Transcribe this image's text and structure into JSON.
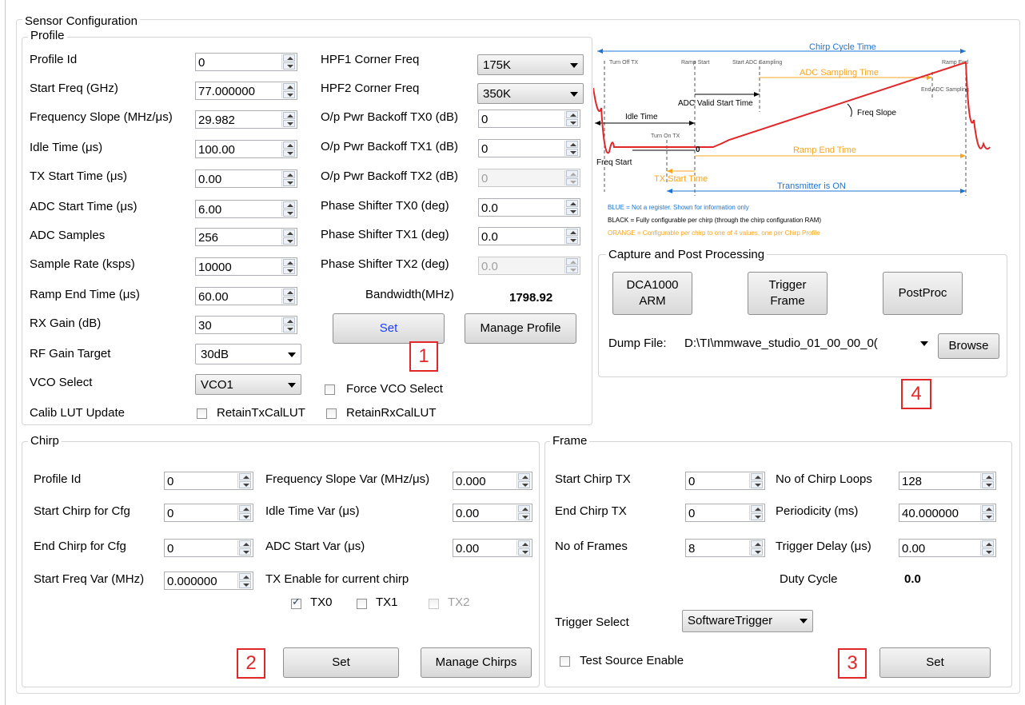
{
  "window": {
    "title": "Sensor Configuration"
  },
  "markers": [
    "1",
    "2",
    "3",
    "4"
  ],
  "profile": {
    "title": "Profile",
    "left_fields": [
      {
        "label": "Profile Id",
        "value": "0"
      },
      {
        "label": "Start Freq (GHz)",
        "value": "77.000000"
      },
      {
        "label": "Frequency Slope (MHz/μs)",
        "value": "29.982"
      },
      {
        "label": "Idle Time (μs)",
        "value": "100.00"
      },
      {
        "label": "TX Start Time (μs)",
        "value": "0.00"
      },
      {
        "label": "ADC Start Time (μs)",
        "value": "6.00"
      },
      {
        "label": "ADC Samples",
        "value": "256"
      },
      {
        "label": "Sample Rate (ksps)",
        "value": "10000"
      },
      {
        "label": "Ramp End Time (μs)",
        "value": "60.00"
      },
      {
        "label": "RX Gain (dB)",
        "value": "30"
      }
    ],
    "rf_gain_target": {
      "label": "RF Gain Target",
      "value": "30dB"
    },
    "vco_select": {
      "label": "VCO Select",
      "value": "VCO1"
    },
    "force_vco": {
      "label": "Force VCO Select",
      "checked": false
    },
    "calib": {
      "label": "Calib LUT Update",
      "tx_label": "RetainTxCalLUT",
      "rx_label": "RetainRxCalLUT"
    },
    "hpf1": {
      "label": "HPF1 Corner Freq",
      "value": "175K"
    },
    "hpf2": {
      "label": "HPF2 Corner Freq",
      "value": "350K"
    },
    "right_fields": [
      {
        "label": "O/p Pwr Backoff TX0 (dB)",
        "value": "0",
        "disabled": false
      },
      {
        "label": "O/p Pwr Backoff TX1 (dB)",
        "value": "0",
        "disabled": false
      },
      {
        "label": "O/p Pwr Backoff TX2 (dB)",
        "value": "0",
        "disabled": true
      },
      {
        "label": "Phase Shifter TX0 (deg)",
        "value": "0.0",
        "disabled": false
      },
      {
        "label": "Phase Shifter TX1 (deg)",
        "value": "0.0",
        "disabled": false
      },
      {
        "label": "Phase Shifter TX2 (deg)",
        "value": "0.0",
        "disabled": true
      }
    ],
    "bandwidth_label": "Bandwidth(MHz)",
    "bandwidth_value": "1798.92",
    "set_label": "Set",
    "manage_label": "Manage Profile"
  },
  "diagram": {
    "chirp_cycle": "Chirp Cycle Time",
    "turn_off_tx": "Turn Off TX",
    "ramp_start": "Ramp Start",
    "start_adc": "Start ADC Sampling",
    "ramp_end": "Ramp End",
    "adc_sampling_time": "ADC Sampling Time",
    "end_adc": "End ADC Sampling",
    "adc_valid_start": "ADC Valid Start Time",
    "idle_time": "Idle Time",
    "freq_slope": "Freq Slope",
    "turn_on_tx": "Turn On TX",
    "zero": "0",
    "ramp_end_time": "Ramp End Time",
    "freq_start": "Freq Start",
    "tx_start_time": "TX Start Time",
    "transmitter_on": "Transmitter is ON",
    "legend_blue": "BLUE = Not a register. Shown for information only",
    "legend_black": "BLACK = Fully configurable per chirp (through the chirp configuration RAM)",
    "legend_orange": "ORANGE = Configurable per chirp to one of 4 values, one per Chirp Profile",
    "colors": {
      "blue": "#1e73d2",
      "orange": "#f5a623",
      "red": "#e0282a"
    }
  },
  "capture": {
    "title": "Capture and Post Processing",
    "dca_label": "DCA1000 ARM",
    "trigger_label": "Trigger Frame",
    "postproc_label": "PostProc",
    "dump_label": "Dump File:",
    "dump_value": "D:\\TI\\mmwave_studio_01_00_00_0(",
    "browse_label": "Browse"
  },
  "chirp": {
    "title": "Chirp",
    "left_fields": [
      {
        "label": "Profile Id",
        "value": "0"
      },
      {
        "label": "Start Chirp for Cfg",
        "value": "0"
      },
      {
        "label": "End Chirp for Cfg",
        "value": "0"
      },
      {
        "label": "Start Freq Var (MHz)",
        "value": "0.000000"
      }
    ],
    "right_fields": [
      {
        "label": "Frequency Slope Var (MHz/μs)",
        "value": "0.000"
      },
      {
        "label": "Idle Time Var (μs)",
        "value": "0.00"
      },
      {
        "label": "ADC Start Var (μs)",
        "value": "0.00"
      }
    ],
    "tx_enable_label": "TX Enable for current chirp",
    "tx": [
      {
        "label": "TX0",
        "checked": true,
        "disabled": false
      },
      {
        "label": "TX1",
        "checked": false,
        "disabled": false
      },
      {
        "label": "TX2",
        "checked": false,
        "disabled": true
      }
    ],
    "set_label": "Set",
    "manage_label": "Manage Chirps"
  },
  "frame": {
    "title": "Frame",
    "left_fields": [
      {
        "label": "Start Chirp TX",
        "value": "0"
      },
      {
        "label": "End Chirp TX",
        "value": "0"
      },
      {
        "label": "No of Frames",
        "value": "8"
      }
    ],
    "right_fields": [
      {
        "label": "No of Chirp Loops",
        "value": "128"
      },
      {
        "label": "Periodicity (ms)",
        "value": "40.000000"
      },
      {
        "label": "Trigger Delay (μs)",
        "value": "0.00"
      }
    ],
    "duty_label": "Duty Cycle",
    "duty_value": "0.0",
    "trigger_select_label": "Trigger Select",
    "trigger_select_value": "SoftwareTrigger",
    "test_source_label": "Test Source Enable",
    "set_label": "Set"
  }
}
